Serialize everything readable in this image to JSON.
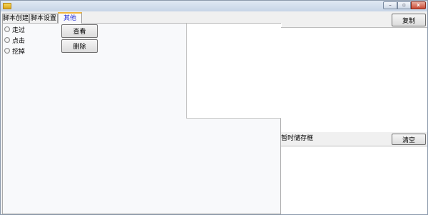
{
  "window": {
    "title": "",
    "controls": {
      "minimize": "–",
      "maximize": "▫",
      "close": "x"
    }
  },
  "tabs": [
    {
      "label": "脚本创建",
      "active": false
    },
    {
      "label": "脚本设置",
      "active": false
    },
    {
      "label": "其他",
      "active": true
    }
  ],
  "other_tab": {
    "radio_options": [
      {
        "label": "走过",
        "checked": false
      },
      {
        "label": "点击",
        "checked": false
      },
      {
        "label": "挖掉",
        "checked": false
      }
    ],
    "view_button": "查看",
    "delete_button": "删除"
  },
  "right_panel": {
    "copy_button": "复制",
    "temp_storage_label": "暂时储存框",
    "clear_button": "清空"
  },
  "colors": {
    "active_tab_text": "#1f2ad6",
    "active_tab_highlight": "#f2b53a",
    "panel_background": "#f8f9fb"
  },
  "icons": {
    "app": "app-icon",
    "minimize": "minimize-icon",
    "maximize": "maximize-icon",
    "close": "close-icon"
  }
}
